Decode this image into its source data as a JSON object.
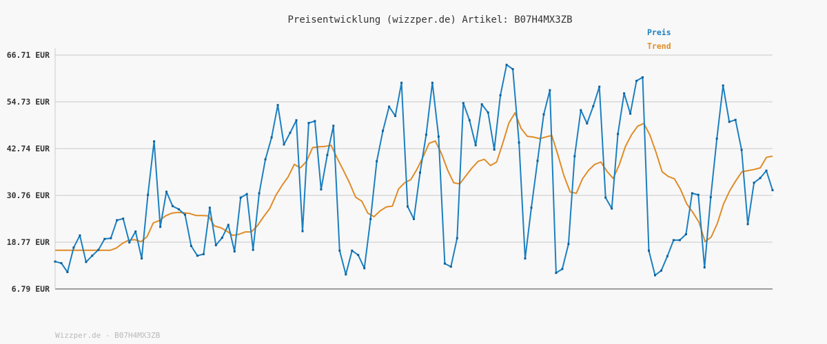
{
  "chart_data": {
    "type": "line",
    "title": "Preisentwicklung (wizzper.de) Artikel: B07H4MX3ZB",
    "footer": "Wizzper.de - B07H4MX3ZB",
    "ylim": [
      6.79,
      66.71
    ],
    "yticks": [
      "66.71 EUR",
      "54.73 EUR",
      "42.74 EUR",
      "30.76 EUR",
      "18.77 EUR",
      "6.79 EUR"
    ],
    "ytick_values": [
      66.71,
      54.73,
      42.74,
      30.76,
      18.77,
      6.79
    ],
    "grid": true,
    "legend_position": "top-right",
    "colors": {
      "preis": "#1a7fc0",
      "trend": "#e08b25"
    },
    "series": [
      {
        "name": "Preis",
        "values": [
          13.8,
          13.4,
          11.1,
          17.4,
          20.5,
          13.7,
          15.3,
          16.8,
          19.6,
          19.8,
          24.4,
          24.8,
          18.7,
          21.5,
          14.6,
          30.9,
          44.6,
          22.7,
          31.7,
          28.0,
          27.2,
          25.8,
          17.8,
          15.3,
          15.7,
          27.6,
          18.0,
          19.9,
          23.2,
          16.4,
          30.2,
          31.1,
          16.8,
          31.3,
          40.0,
          45.6,
          53.9,
          43.8,
          46.8,
          50.0,
          21.6,
          49.3,
          49.8,
          32.3,
          41.1,
          48.6,
          16.6,
          10.5,
          16.6,
          15.5,
          12.1,
          24.7,
          39.5,
          47.3,
          53.5,
          51.1,
          59.6,
          27.9,
          24.7,
          36.6,
          46.3,
          59.6,
          45.8,
          13.3,
          12.5,
          19.8,
          54.4,
          50.0,
          43.6,
          54.1,
          52.0,
          42.5,
          56.4,
          64.2,
          63.1,
          44.3,
          14.6,
          27.6,
          39.6,
          51.5,
          57.7,
          10.9,
          11.9,
          18.3,
          40.8,
          52.6,
          49.2,
          53.6,
          58.6,
          30.2,
          27.4,
          46.5,
          56.9,
          51.7,
          60.1,
          61.0,
          16.6,
          10.3,
          11.5,
          15.2,
          19.3,
          19.3,
          20.8,
          31.3,
          30.9,
          12.3,
          30.3,
          45.3,
          58.9,
          49.6,
          50.1,
          42.4,
          23.4,
          34.0,
          35.2,
          37.1,
          32.1
        ]
      },
      {
        "name": "Trend",
        "values": [
          16.7,
          16.7,
          16.7,
          16.7,
          16.7,
          16.7,
          16.7,
          16.7,
          16.7,
          16.7,
          17.3,
          18.5,
          19.3,
          19.4,
          18.9,
          20.2,
          23.7,
          24.3,
          25.5,
          26.2,
          26.4,
          26.3,
          26.1,
          25.6,
          25.6,
          25.5,
          22.9,
          22.5,
          21.6,
          20.5,
          20.8,
          21.4,
          21.4,
          23.0,
          25.3,
          27.4,
          30.8,
          33.3,
          35.5,
          38.7,
          37.8,
          39.5,
          43.0,
          43.2,
          43.3,
          43.6,
          40.3,
          37.2,
          34.0,
          30.3,
          29.3,
          26.2,
          25.3,
          26.8,
          27.8,
          28.0,
          32.4,
          34.0,
          34.8,
          37.4,
          40.6,
          44.1,
          44.7,
          41.5,
          37.3,
          34.0,
          33.7,
          35.8,
          37.8,
          39.5,
          40.0,
          38.4,
          39.3,
          44.1,
          49.3,
          51.9,
          47.9,
          45.9,
          45.7,
          45.3,
          45.7,
          46.1,
          41.1,
          35.7,
          31.6,
          31.3,
          35.0,
          37.2,
          38.7,
          39.3,
          36.9,
          35.1,
          38.6,
          43.3,
          46.3,
          48.5,
          49.2,
          46.2,
          41.8,
          36.8,
          35.6,
          35.0,
          32.3,
          28.6,
          26.4,
          23.9,
          18.9,
          20.1,
          23.6,
          28.5,
          31.9,
          34.5,
          36.8,
          37.1,
          37.4,
          37.8,
          40.5,
          40.8
        ]
      }
    ]
  }
}
